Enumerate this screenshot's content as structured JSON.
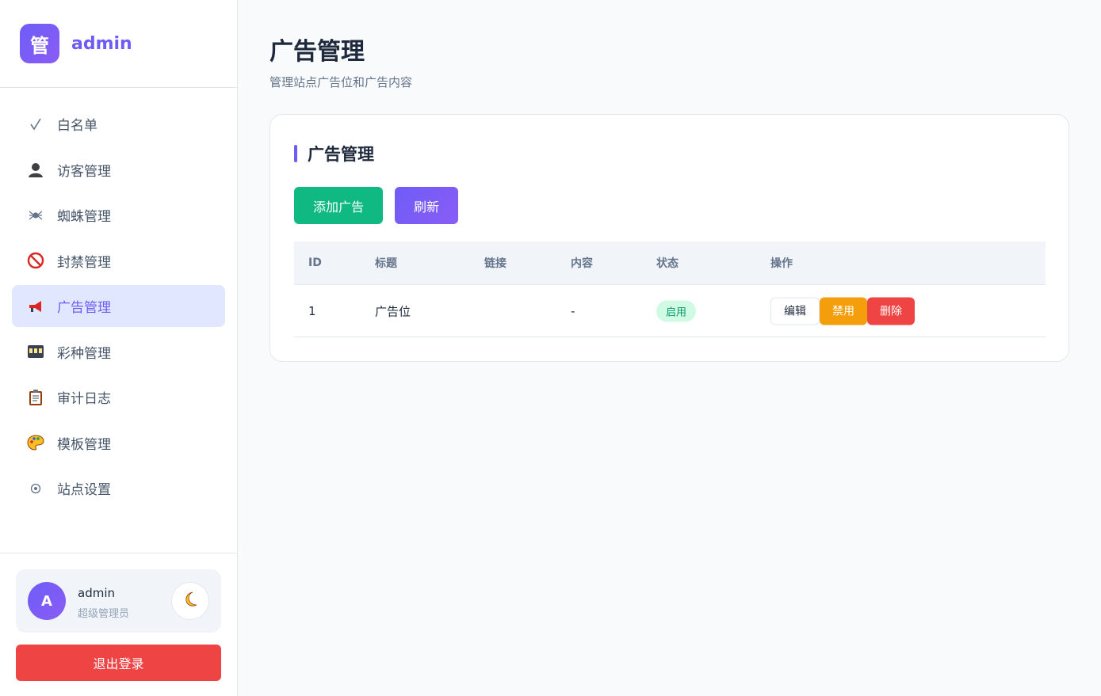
{
  "brand": {
    "logo_text": "管",
    "name": "admin"
  },
  "sidebar": {
    "items": [
      {
        "label": "白名单",
        "icon": "check-icon"
      },
      {
        "label": "访客管理",
        "icon": "visitor-icon"
      },
      {
        "label": "蜘蛛管理",
        "icon": "spider-icon"
      },
      {
        "label": "封禁管理",
        "icon": "prohibited-icon"
      },
      {
        "label": "广告管理",
        "icon": "megaphone-icon",
        "active": true
      },
      {
        "label": "彩种管理",
        "icon": "slot-machine-icon"
      },
      {
        "label": "审计日志",
        "icon": "clipboard-icon"
      },
      {
        "label": "模板管理",
        "icon": "palette-icon"
      },
      {
        "label": "站点设置",
        "icon": "gear-icon"
      }
    ]
  },
  "user": {
    "avatar_letter": "A",
    "name": "admin",
    "role": "超级管理员",
    "theme_icon": "moon-icon"
  },
  "logout_label": "退出登录",
  "page": {
    "title": "广告管理",
    "subtitle": "管理站点广告位和广告内容"
  },
  "card": {
    "title": "广告管理",
    "add_label": "添加广告",
    "refresh_label": "刷新",
    "columns": [
      "ID",
      "标题",
      "链接",
      "内容",
      "状态",
      "操作"
    ],
    "rows": [
      {
        "id": "1",
        "title": "广告位",
        "link": "",
        "content": "-",
        "status": "启用",
        "edit_label": "编辑",
        "disable_label": "禁用",
        "delete_label": "删除"
      }
    ]
  },
  "colors": {
    "accent": "#6d5df6",
    "success": "#10b981",
    "warning": "#f59e0b",
    "danger": "#ef4444"
  }
}
